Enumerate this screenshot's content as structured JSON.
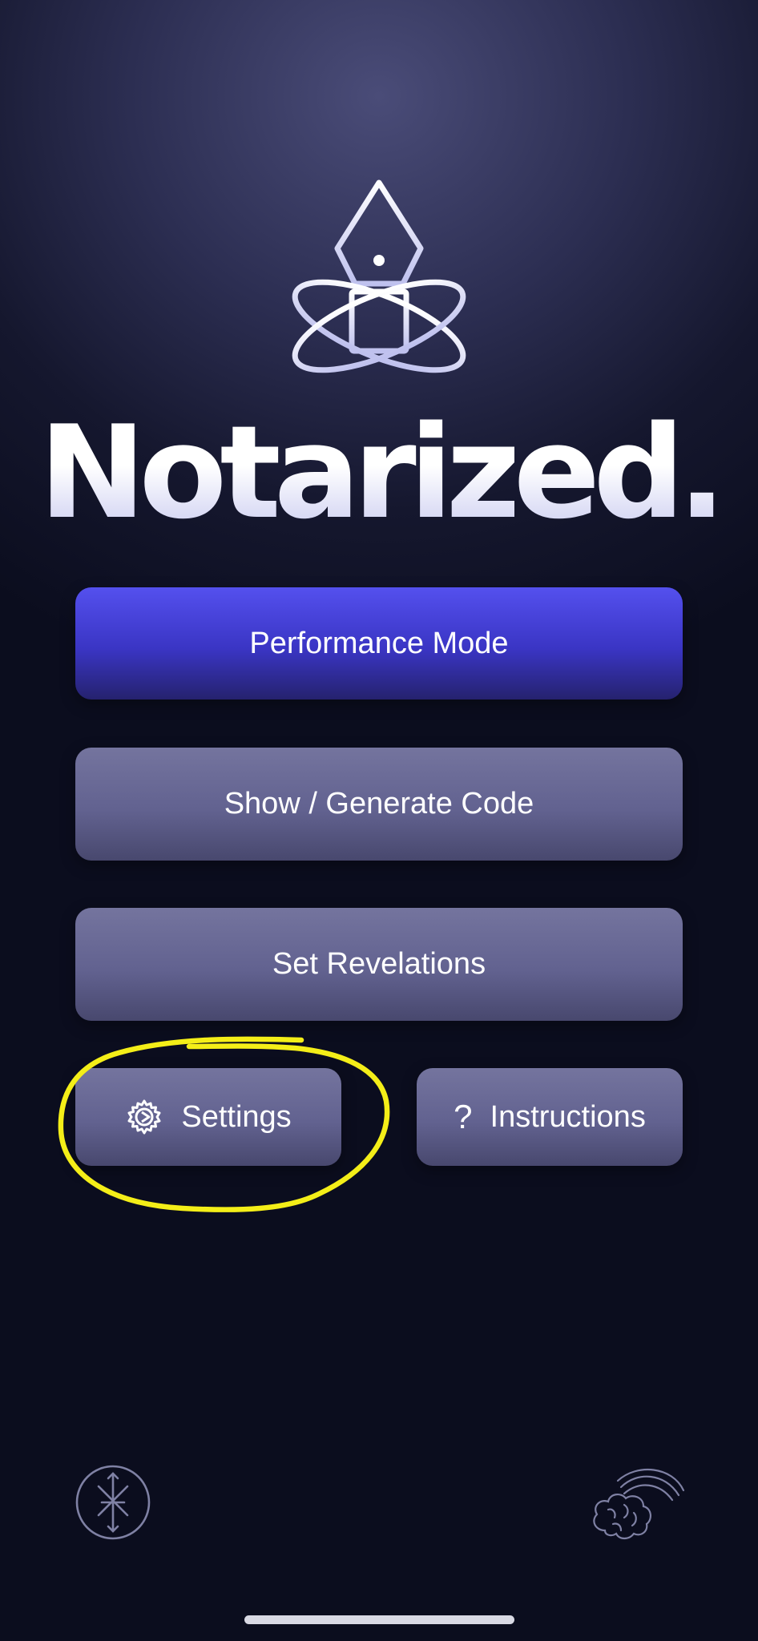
{
  "app": {
    "title": "Notarized."
  },
  "buttons": {
    "performance_mode": "Performance Mode",
    "show_generate_code": "Show / Generate Code",
    "set_revelations": "Set Revelations",
    "settings": "Settings",
    "instructions": "Instructions"
  },
  "icons": {
    "logo": "fountain-pen-orbit-icon",
    "settings": "gear-icon",
    "instructions": "question-mark-icon",
    "instructions_glyph": "?",
    "bottom_left": "compass-cross-icon",
    "bottom_right": "brain-signal-icon"
  },
  "colors": {
    "primary_button": "#4a46e0",
    "secondary_button": "#666693",
    "background_top": "#4a4c78",
    "background_bottom": "#0b0d1e",
    "highlight_annotation": "#f4ee18"
  }
}
